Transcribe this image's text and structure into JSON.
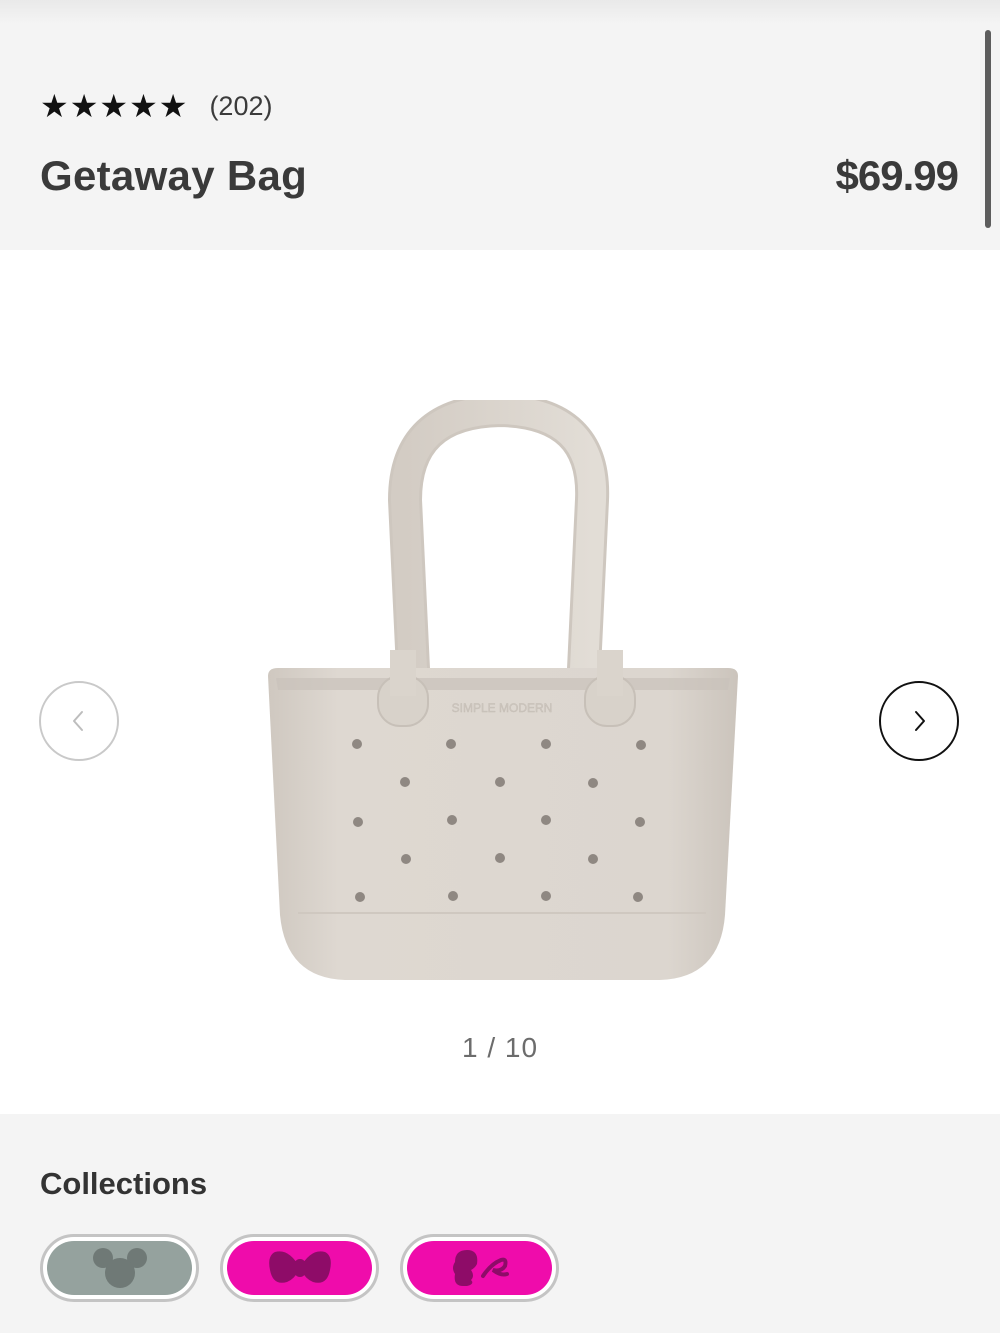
{
  "product": {
    "rating_stars": 5,
    "review_count": "(202)",
    "title": "Getaway Bag",
    "price": "$69.99"
  },
  "gallery": {
    "image_brand_text": "SIMPLE MODERN",
    "pager": "1 / 10",
    "prev_icon": "chevron-left-icon",
    "next_icon": "chevron-right-icon"
  },
  "collections": {
    "title": "Collections",
    "items": [
      {
        "icon": "mickey-ears-icon",
        "color": "#95a29e"
      },
      {
        "icon": "bow-icon",
        "color": "#ef0cab"
      },
      {
        "icon": "barbie-silhouette-icon",
        "color": "#ef0cab"
      }
    ]
  },
  "colors": {
    "accent_pink": "#ef0cab",
    "sage": "#95a29e",
    "bag": "#dcd6cf",
    "header_bg": "#f4f4f4"
  }
}
